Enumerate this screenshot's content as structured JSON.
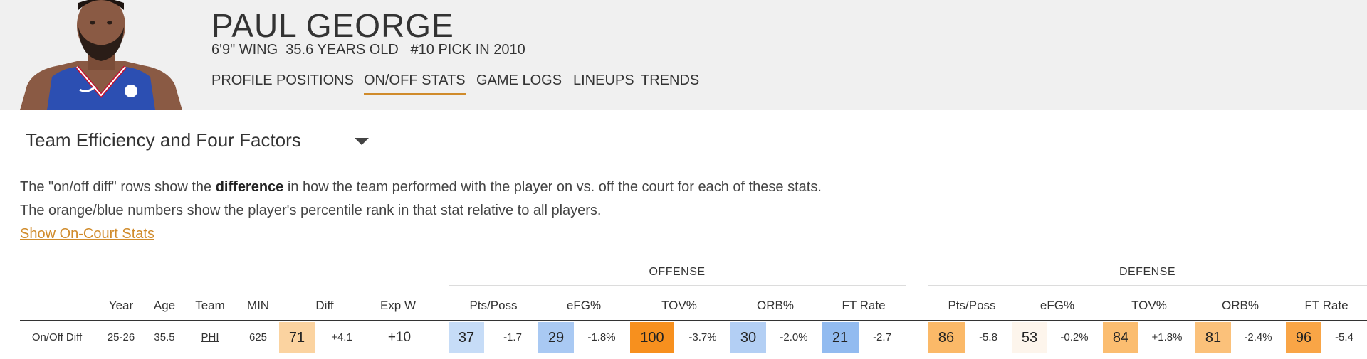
{
  "player": {
    "name": "PAUL GEORGE",
    "meta": "6'9\" WING  35.6 YEARS OLD   #10 PICK IN 2010"
  },
  "nav": {
    "tabs": [
      "PROFILE",
      "POSITIONS",
      "ON/OFF STATS",
      "GAME LOGS",
      "LINEUPS",
      "TRENDS"
    ],
    "active": "ON/OFF STATS"
  },
  "selector": {
    "label": "Team Efficiency and Four Factors"
  },
  "description": {
    "line1_pre": "The \"on/off diff\" rows show the ",
    "line1_bold": "difference",
    "line1_post": " in how the team performed with the player on vs. off the court for each of these stats.",
    "line2": "The orange/blue numbers show the player's percentile rank in that stat relative to all players."
  },
  "show_link": "Show On-Court Stats",
  "table": {
    "groups": [
      "OFFENSE",
      "DEFENSE"
    ],
    "headers": {
      "year": "Year",
      "age": "Age",
      "team": "Team",
      "min": "MIN",
      "diff": "Diff",
      "expw": "Exp W",
      "off_pts": "Pts/Poss",
      "off_efg": "eFG%",
      "off_tov": "TOV%",
      "off_orb": "ORB%",
      "off_ft": "FT Rate",
      "def_pts": "Pts/Poss",
      "def_efg": "eFG%",
      "def_tov": "TOV%",
      "def_orb": "ORB%",
      "def_ft": "FT Rate"
    },
    "row": {
      "label": "On/Off Diff",
      "year": "25-26",
      "age": "35.5",
      "team": "PHI",
      "min": "625",
      "diff_pct": "71",
      "diff": "+4.1",
      "expw": "+10",
      "off_pts_pct": "37",
      "off_pts": "-1.7",
      "off_efg_pct": "29",
      "off_efg": "-1.8%",
      "off_tov_pct": "100",
      "off_tov": "-3.7%",
      "off_orb_pct": "30",
      "off_orb": "-2.0%",
      "off_ft_pct": "21",
      "off_ft": "-2.7",
      "def_pts_pct": "86",
      "def_pts": "-5.8",
      "def_efg_pct": "53",
      "def_efg": "-0.2%",
      "def_tov_pct": "84",
      "def_tov": "+1.8%",
      "def_orb_pct": "81",
      "def_orb": "-2.4%",
      "def_ft_pct": "96",
      "def_ft": "-5.4"
    },
    "percentile_colors": {
      "diff": "#fbd3a0",
      "off_pts": "#c6dcf7",
      "off_efg": "#a9c9f3",
      "off_tov": "#f7901e",
      "off_orb": "#b3cff4",
      "off_ft": "#92bbf0",
      "def_pts": "#fbb968",
      "def_efg": "#fdf5ec",
      "def_tov": "#fbbd70",
      "def_orb": "#fbc17a",
      "def_ft": "#f9a546"
    }
  }
}
